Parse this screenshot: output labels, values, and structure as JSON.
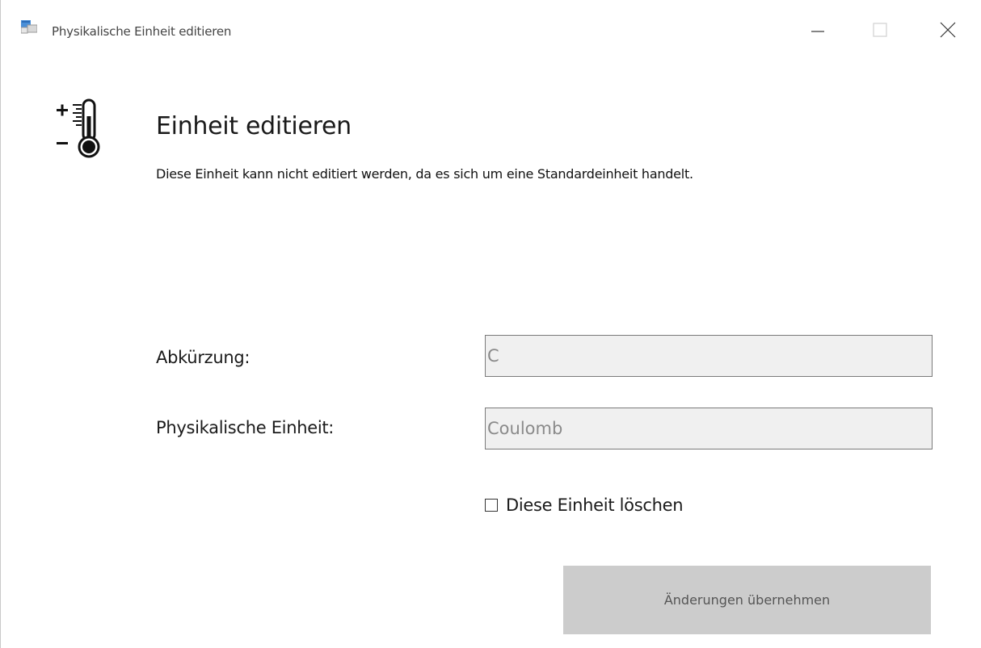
{
  "window": {
    "title": "Physikalische Einheit editieren",
    "buttons": {
      "minimize": "minimize-icon",
      "maximize": "maximize-icon",
      "close": "close-icon"
    }
  },
  "header": {
    "icon": "thermometer-plus-minus-icon",
    "title": "Einheit editieren",
    "message": "Diese Einheit kann nicht editiert werden, da es sich um eine Standardeinheit handelt."
  },
  "form": {
    "abbreviation": {
      "label": "Abkürzung:",
      "value": "C",
      "disabled": true
    },
    "unit_name": {
      "label": "Physikalische Einheit:",
      "value": "Coulomb",
      "disabled": true
    },
    "delete_checkbox": {
      "label": "Diese Einheit löschen",
      "checked": false
    },
    "apply_button": {
      "label": "Änderungen übernehmen",
      "disabled": true
    }
  },
  "colors": {
    "disabled_input_bg": "#f0f0f0",
    "disabled_text": "#8a8a8a",
    "disabled_button_bg": "#cccccc"
  }
}
